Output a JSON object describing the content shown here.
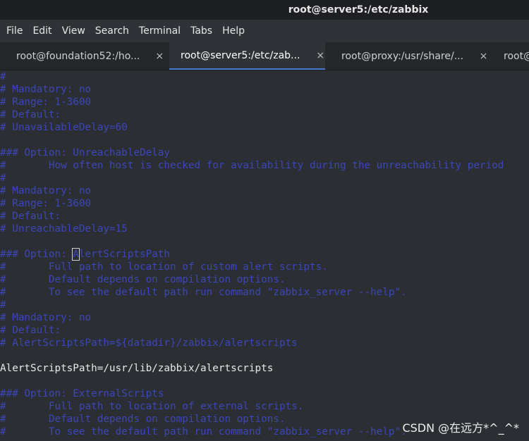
{
  "window": {
    "title": "root@server5:/etc/zabbix"
  },
  "menu": [
    "File",
    "Edit",
    "View",
    "Search",
    "Terminal",
    "Tabs",
    "Help"
  ],
  "tabs": [
    {
      "label": "root@foundation52:/ho...",
      "active": false,
      "close": "×"
    },
    {
      "label": "root@server5:/etc/zab...",
      "active": true,
      "close": "×"
    },
    {
      "label": "root@proxy:/usr/share/...",
      "active": false,
      "close": "×"
    },
    {
      "label": "root@",
      "active": false,
      "close": ""
    }
  ],
  "colors": {
    "comment": "#3c46b8",
    "text": "#e8e8e8",
    "accent": "#4a7bd0",
    "background": "#2b2f34"
  },
  "lines": [
    {
      "text": "#",
      "kind": "comment"
    },
    {
      "text": "# Mandatory: no",
      "kind": "comment"
    },
    {
      "text": "# Range: 1-3600",
      "kind": "comment"
    },
    {
      "text": "# Default:",
      "kind": "comment"
    },
    {
      "text": "# UnavailableDelay=60",
      "kind": "comment"
    },
    {
      "text": "",
      "kind": "comment"
    },
    {
      "text": "### Option: UnreachableDelay",
      "kind": "comment"
    },
    {
      "text": "#       How often host is checked for availability during the unreachability period",
      "kind": "comment"
    },
    {
      "text": "#",
      "kind": "comment"
    },
    {
      "text": "# Mandatory: no",
      "kind": "comment"
    },
    {
      "text": "# Range: 1-3600",
      "kind": "comment"
    },
    {
      "text": "# Default:",
      "kind": "comment"
    },
    {
      "text": "# UnreachableDelay=15",
      "kind": "comment"
    },
    {
      "text": "",
      "kind": "comment"
    },
    {
      "text": "### Option: AlertScriptsPath",
      "kind": "comment",
      "cursor_char": 12
    },
    {
      "text": "#       Full path to location of custom alert scripts.",
      "kind": "comment"
    },
    {
      "text": "#       Default depends on compilation options.",
      "kind": "comment"
    },
    {
      "text": "#       To see the default path run command \"zabbix_server --help\".",
      "kind": "comment"
    },
    {
      "text": "#",
      "kind": "comment"
    },
    {
      "text": "# Mandatory: no",
      "kind": "comment"
    },
    {
      "text": "# Default:",
      "kind": "comment"
    },
    {
      "text": "# AlertScriptsPath=${datadir}/zabbix/alertscripts",
      "kind": "comment"
    },
    {
      "text": "",
      "kind": "comment"
    },
    {
      "text": "AlertScriptsPath=/usr/lib/zabbix/alertscripts",
      "kind": "plain"
    },
    {
      "text": "",
      "kind": "comment"
    },
    {
      "text": "### Option: ExternalScripts",
      "kind": "comment"
    },
    {
      "text": "#       Full path to location of external scripts.",
      "kind": "comment"
    },
    {
      "text": "#       Default depends on compilation options.",
      "kind": "comment"
    },
    {
      "text": "#       To see the default path run command \"zabbix_server --help\".",
      "kind": "comment"
    }
  ],
  "watermark": "CSDN @在远方*^_^*"
}
